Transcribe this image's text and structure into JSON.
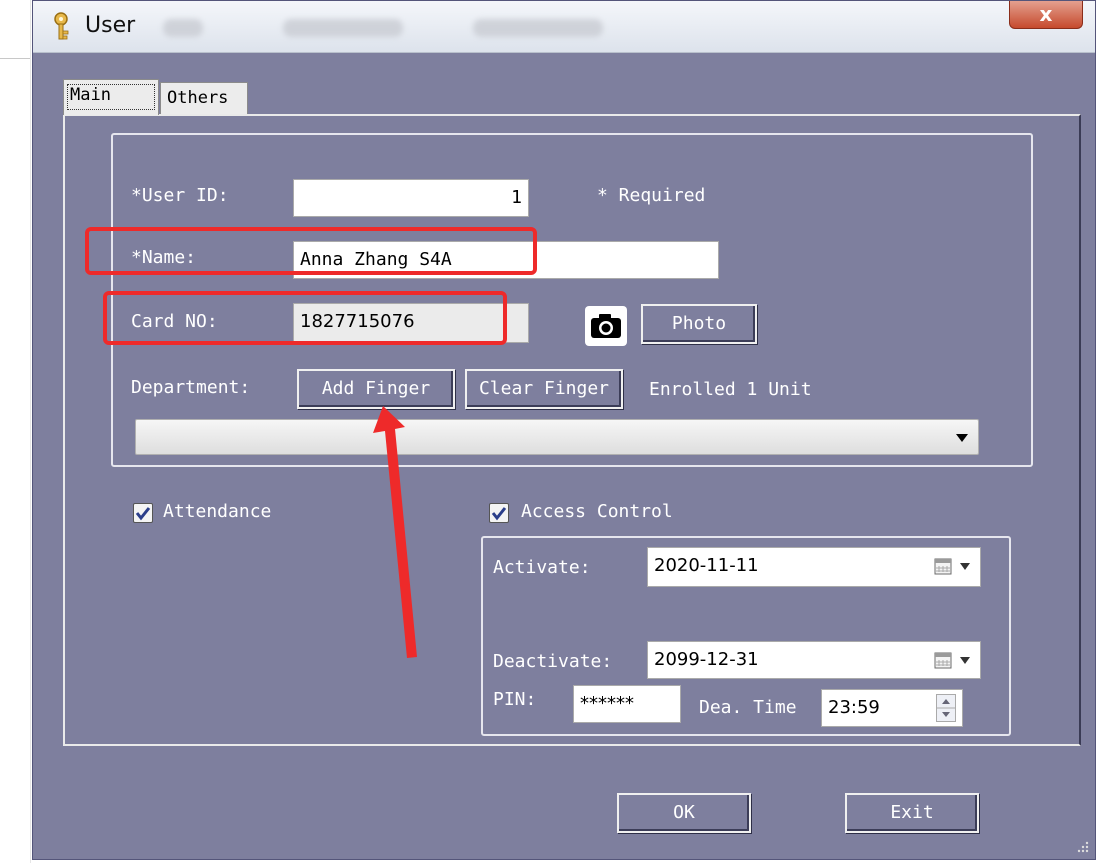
{
  "window": {
    "title": "User",
    "close_label": "x"
  },
  "tabs": [
    {
      "label": "Main"
    },
    {
      "label": "Others"
    }
  ],
  "form": {
    "user_id_label": "*User ID:",
    "user_id_value": "1",
    "required_note": "* Required",
    "name_label": "*Name:",
    "name_value": "Anna Zhang S4A",
    "card_label": "Card NO:",
    "card_value": "1827715076",
    "photo_button": "Photo",
    "department_label": "Department:",
    "add_finger_button": "Add Finger",
    "clear_finger_button": "Clear Finger",
    "enrolled_text": "Enrolled 1 Unit",
    "department_value": ""
  },
  "attendance": {
    "label": "Attendance",
    "checked": true
  },
  "access": {
    "label": "Access Control",
    "checked": true,
    "activate_label": "Activate:",
    "activate_value": "2020-11-11",
    "deactivate_label": "Deactivate:",
    "deactivate_value": "2099-12-31",
    "pin_label": "PIN:",
    "pin_value": "******",
    "dea_time_label": "Dea. Time",
    "dea_time_value": "23:59"
  },
  "footer": {
    "ok_button": "OK",
    "exit_button": "Exit"
  },
  "colors": {
    "window_bg": "#7e7f9e",
    "highlight": "#ee2a2a"
  }
}
